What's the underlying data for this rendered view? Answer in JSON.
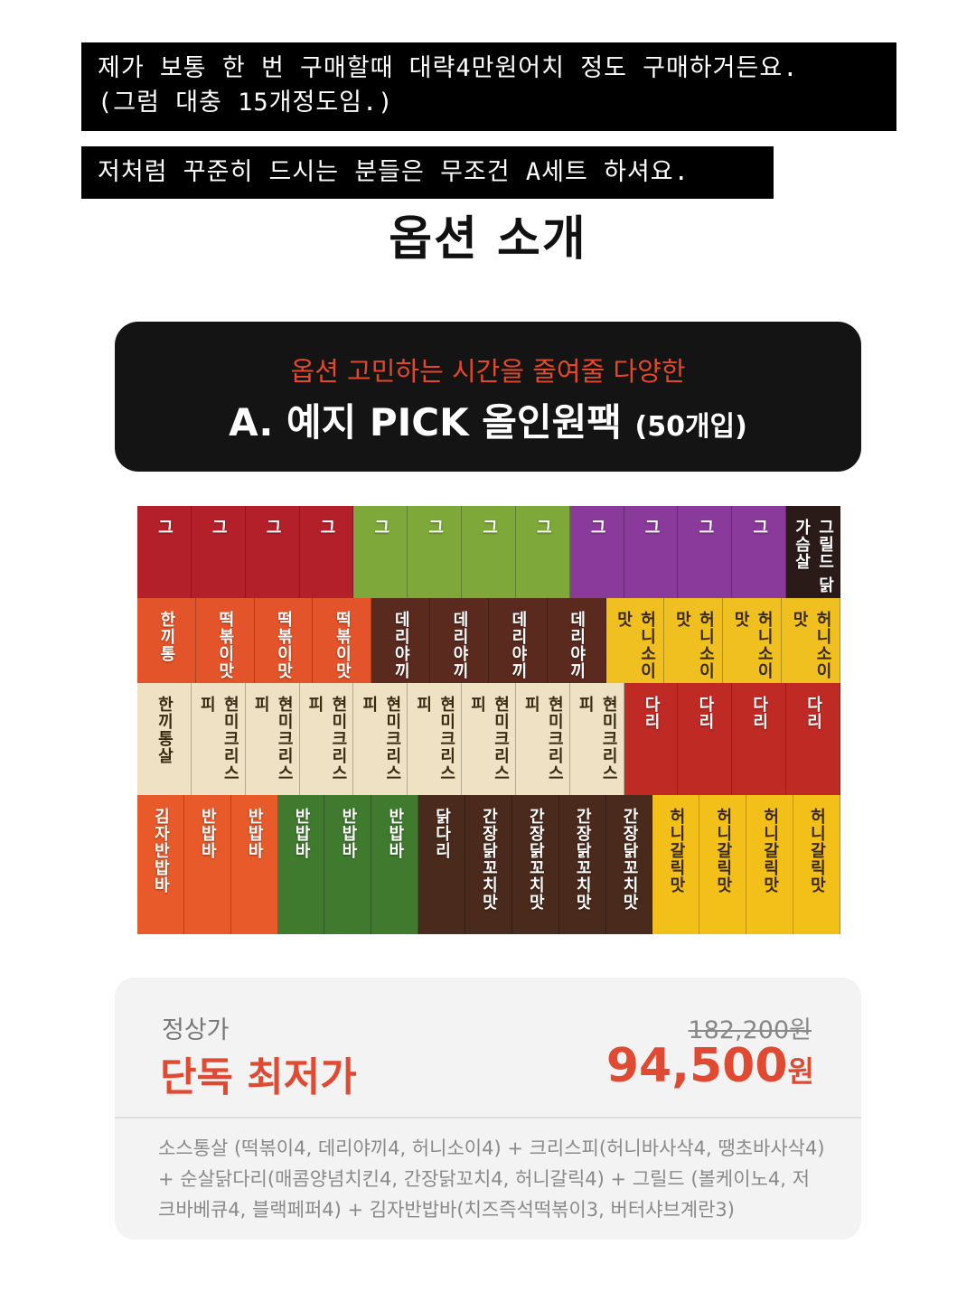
{
  "captions": {
    "line1": "제가 보통 한 번 구매할때 대략4만원어치 정도 구매하거든요.\n(그럼 대충 15개정도임.)",
    "line2": "저처럼 꾸준히 드시는 분들은 무조건 A세트 하셔요."
  },
  "section_title": "옵션 소개",
  "banner": {
    "subtitle": "옵션 고민하는 시간을 줄여줄 다양한",
    "title": "A. 예지 PICK 올인원팩",
    "count": "(50개입)"
  },
  "product_image": {
    "row1_packs": [
      "그",
      "그",
      "그",
      "그",
      "그",
      "그",
      "그",
      "그",
      "그",
      "그",
      "그",
      "그",
      "그릴드 닭가슴살"
    ],
    "row2_packs": [
      "한끼통",
      "떡볶이맛",
      "떡볶이맛",
      "떡볶이맛",
      "데리야끼",
      "데리야끼",
      "데리야끼",
      "데리야끼",
      "허니소이맛",
      "허니소이맛",
      "허니소이맛",
      "허니소이맛"
    ],
    "row3_packs": [
      "한끼통살",
      "현미크리스피",
      "현미크리스피",
      "현미크리스피",
      "현미크리스피",
      "현미크리스피",
      "현미크리스피",
      "현미크리스피",
      "현미크리스피",
      "다리",
      "다리",
      "다리",
      "다리"
    ],
    "row4_packs": [
      "김자반밥바",
      "반밥바",
      "반밥바",
      "반밥바",
      "반밥바",
      "반밥바",
      "닭다리",
      "간장닭꼬치맛",
      "간장닭꼬치맛",
      "간장닭꼬치맛",
      "간장닭꼬치맛",
      "허니갈릭맛",
      "허니갈릭맛",
      "허니갈릭맛",
      "허니갈릭맛"
    ]
  },
  "price_card": {
    "regular_label": "정상가",
    "regular_price": "182,200원",
    "deal_label": "단독 최저가",
    "deal_price": "94,500",
    "deal_unit": "원",
    "composition": "소스통살 (떡볶이4, 데리야끼4, 허니소이4) + 크리스피(허니바사삭4, 땡초바사삭4) + 순살닭다리(매콤양념치킨4, 간장닭꼬치4, 허니갈릭4) + 그릴드 (볼케이노4, 저크바베큐4, 블랙페퍼4) + 김자반밥바(치즈즉석떡볶이3, 버터샤브계란3)"
  },
  "colors": {
    "accent_red": "#e04a32",
    "banner_bg": "#141414",
    "card_bg": "#f3f3f3"
  }
}
